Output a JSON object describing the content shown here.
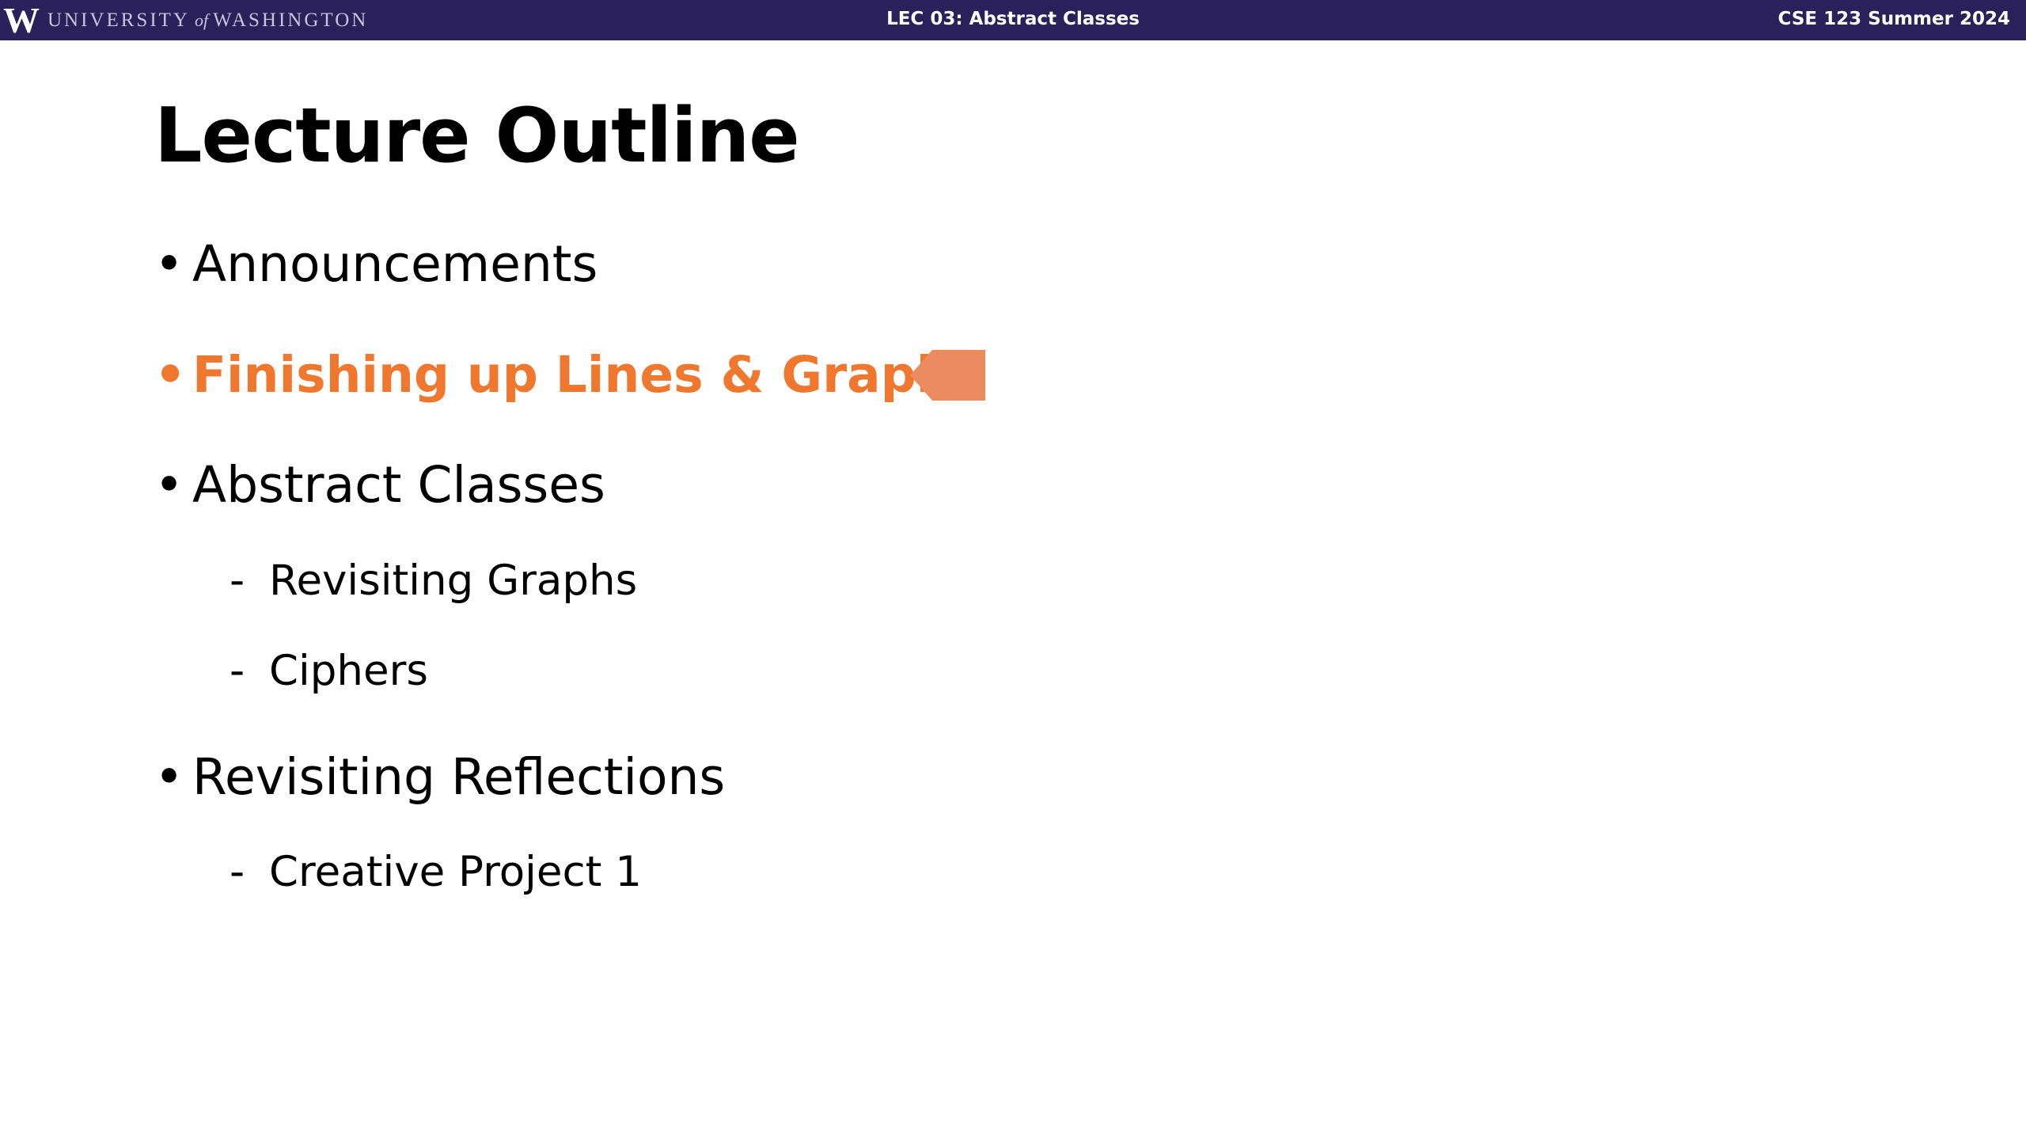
{
  "header": {
    "logo_letter": "W",
    "university_left": "UNIVERSITY",
    "university_of": "of",
    "university_right": "WASHINGTON",
    "lecture_title": "LEC 03: Abstract Classes",
    "course_title": "CSE 123 Summer 2024",
    "bar_color": "#2b215a"
  },
  "slide": {
    "title": "Lecture Outline",
    "accent_color": "#f0782e",
    "items": [
      {
        "marker": "•",
        "label": "Announcements"
      },
      {
        "marker": "•",
        "label": "Finishing up Lines & Graphs",
        "current": true
      },
      {
        "marker": "•",
        "label": "Abstract Classes"
      },
      {
        "marker": "-",
        "label": "Revisiting Graphs"
      },
      {
        "marker": "-",
        "label": "Ciphers"
      },
      {
        "marker": "•",
        "label": "Revisiting Reflections"
      },
      {
        "marker": "-",
        "label": "Creative Project 1"
      }
    ],
    "current_indicator_icon": "arrow-left-icon"
  }
}
